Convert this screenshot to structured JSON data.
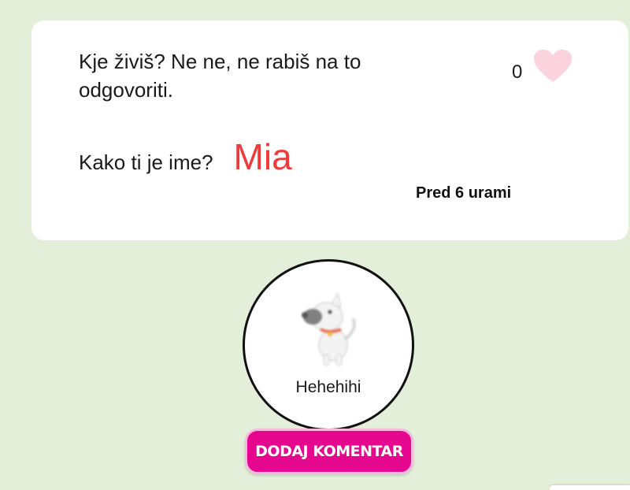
{
  "post": {
    "question_1": "Kje živiš? Ne ne, ne rabiš na to odgovoriti.",
    "question_2": "Kako ti je ime?",
    "answer": "Mia",
    "likes": "0",
    "timestamp": "Pred 6 urami"
  },
  "profile": {
    "username": "Hehehihi",
    "avatar_icon": "dog-avatar-icon"
  },
  "actions": {
    "comment_label": "DODAJ KOMENTAR"
  },
  "colors": {
    "background": "#e3efd9",
    "answer": "#ef3b3b",
    "heart": "#fbd3de",
    "button": "#e5088e"
  }
}
